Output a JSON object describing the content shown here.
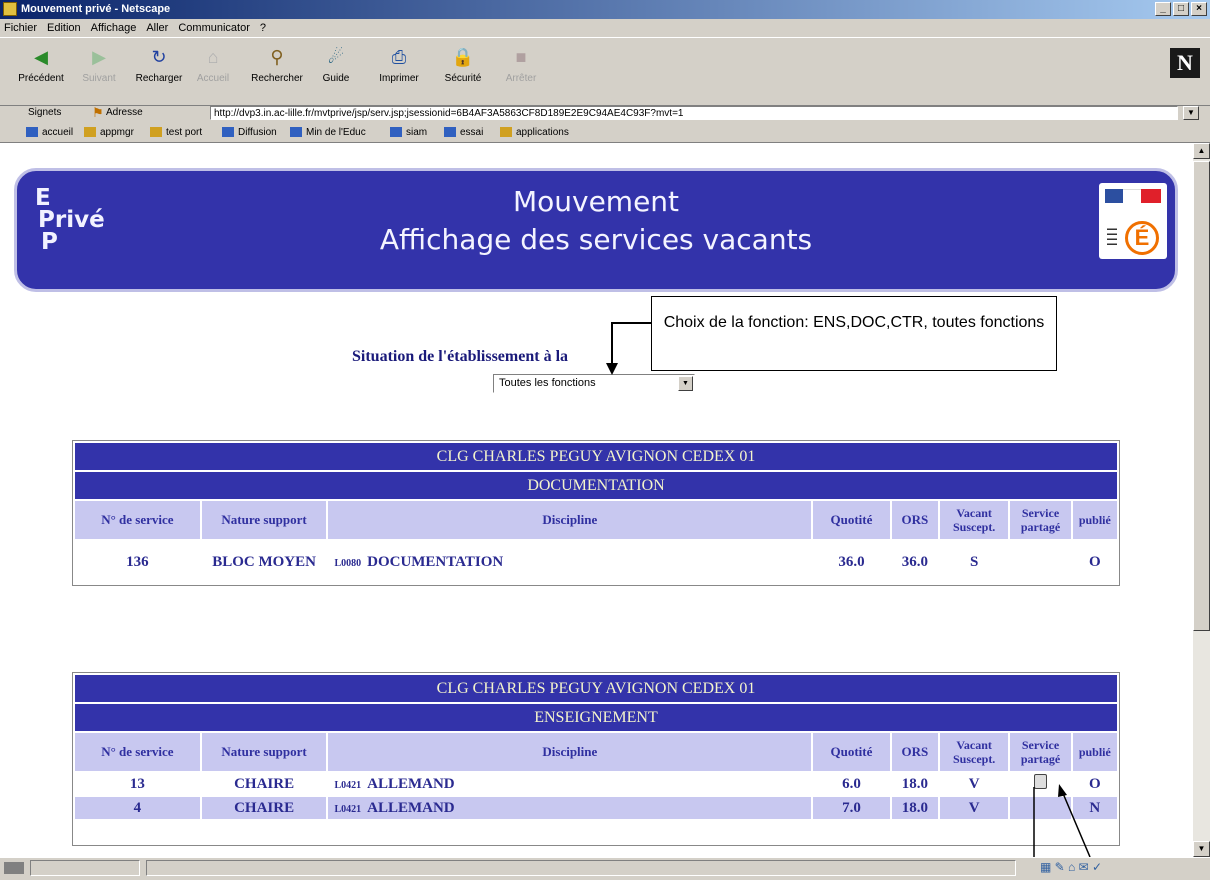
{
  "window": {
    "title": "Mouvement privé - Netscape",
    "controls": {
      "minimize": "_",
      "maximize": "□",
      "close": "×"
    }
  },
  "menu": [
    "Fichier",
    "Edition",
    "Affichage",
    "Aller",
    "Communicator",
    "?"
  ],
  "toolbar": {
    "buttons": [
      {
        "label": "Précédent",
        "icon": "back-arrow-icon",
        "enabled": true
      },
      {
        "label": "Suivant",
        "icon": "forward-arrow-icon",
        "enabled": false
      },
      {
        "label": "Recharger",
        "icon": "reload-icon",
        "enabled": true
      },
      {
        "label": "Accueil",
        "icon": "home-icon",
        "enabled": false
      },
      {
        "label": "Rechercher",
        "icon": "search-icon",
        "enabled": true
      },
      {
        "label": "Guide",
        "icon": "guide-icon",
        "enabled": true
      },
      {
        "label": "Imprimer",
        "icon": "printer-icon",
        "enabled": true
      },
      {
        "label": "Sécurité",
        "icon": "lock-icon",
        "enabled": true
      },
      {
        "label": "Arrêter",
        "icon": "stop-icon",
        "enabled": false
      }
    ],
    "brand": "N"
  },
  "location": {
    "bookmarks_label": "Signets",
    "address_label": "Adresse",
    "url": "http://dvp3.in.ac-lille.fr/mvtprive/jsp/serv.jsp;jsessionid=6B4AF3A5863CF8D189E2E9C94AE4C93F?mvt=1"
  },
  "personal_bar": [
    "accueil",
    "appmgr",
    "test port",
    "Diffusion",
    "Min de l'Educ",
    "siam",
    "essai",
    "applications"
  ],
  "banner": {
    "logo_lines": [
      "E",
      "Privé",
      "P"
    ],
    "title_line1": "Mouvement",
    "title_line2": "Affichage des services vacants",
    "ministry_letter": "É"
  },
  "situation_title": "Situation de l'établissement à la",
  "callout_text": "Choix de la fonction: ENS,DOC,CTR, toutes fonctions",
  "function_select": {
    "value": "Toutes les fonctions"
  },
  "columns": [
    "N° de service",
    "Nature support",
    "Discipline",
    "Quotité",
    "ORS",
    "Vacant Suscept.",
    "Service partagé",
    "publié"
  ],
  "tables": [
    {
      "establishment": "CLG CHARLES PEGUY AVIGNON CEDEX 01",
      "function": "DOCUMENTATION",
      "rows": [
        {
          "no": "136",
          "nature": "BLOC MOYEN",
          "code": "L0080",
          "discipline": "DOCUMENTATION",
          "quotite": "36.0",
          "ors": "36.0",
          "vacant": "S",
          "partage": "",
          "publie": "O"
        }
      ]
    },
    {
      "establishment": "CLG CHARLES PEGUY AVIGNON CEDEX 01",
      "function": "ENSEIGNEMENT",
      "rows": [
        {
          "no": "13",
          "nature": "CHAIRE",
          "code": "L0421",
          "discipline": "ALLEMAND",
          "quotite": "6.0",
          "ors": "18.0",
          "vacant": "V",
          "partage": "icon",
          "publie": "O"
        },
        {
          "no": "4",
          "nature": "CHAIRE",
          "code": "L0421",
          "discipline": "ALLEMAND",
          "quotite": "7.0",
          "ors": "18.0",
          "vacant": "V",
          "partage": "",
          "publie": "N"
        }
      ]
    }
  ]
}
